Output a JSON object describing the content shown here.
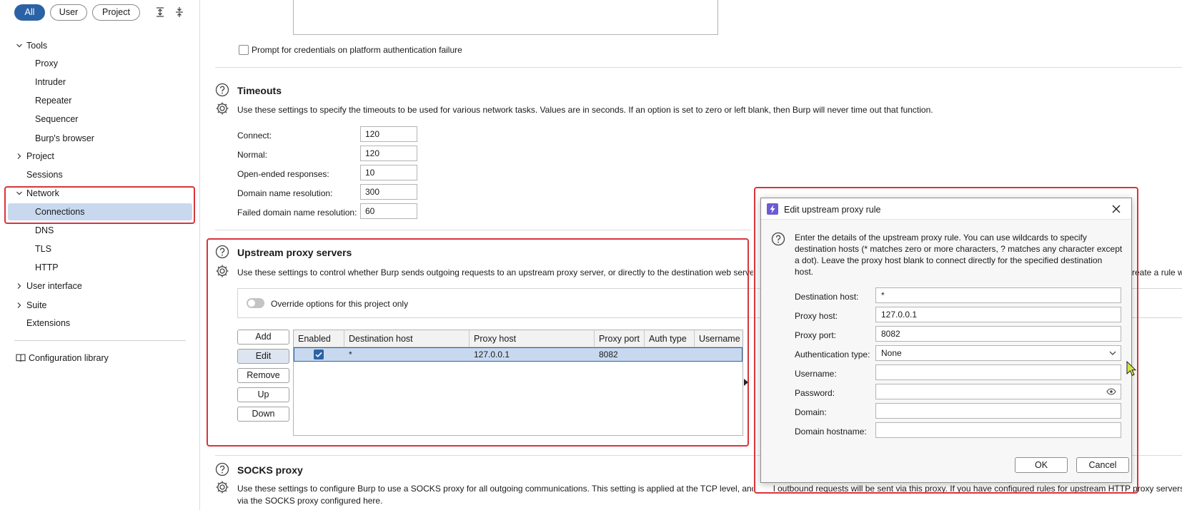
{
  "filters": {
    "all": "All",
    "user": "User",
    "project": "Project"
  },
  "sidebar": {
    "tools": "Tools",
    "proxy": "Proxy",
    "intruder": "Intruder",
    "repeater": "Repeater",
    "sequencer": "Sequencer",
    "burps_browser": "Burp's browser",
    "project": "Project",
    "sessions": "Sessions",
    "network": "Network",
    "connections": "Connections",
    "dns": "DNS",
    "tls": "TLS",
    "http": "HTTP",
    "user_interface": "User interface",
    "suite": "Suite",
    "extensions": "Extensions",
    "configuration_library": "Configuration library"
  },
  "auth": {
    "prompt_label": "Prompt for credentials on platform authentication failure"
  },
  "timeouts": {
    "title": "Timeouts",
    "description": "Use these settings to specify the timeouts to be used for various network tasks. Values are in seconds. If an option is set to zero or left blank, then Burp will never time out that function.",
    "fields": [
      {
        "label": "Connect:",
        "value": "120"
      },
      {
        "label": "Normal:",
        "value": "120"
      },
      {
        "label": "Open-ended responses:",
        "value": "10"
      },
      {
        "label": "Domain name resolution:",
        "value": "300"
      },
      {
        "label": "Failed domain name resolution:",
        "value": "60"
      }
    ]
  },
  "upstream": {
    "title": "Upstream proxy servers",
    "description_left": "Use these settings to control whether Burp sends outgoing requests to an upstream proxy server, or directly to the destination web server. Th",
    "description_right": "reate a rule wi",
    "override_label": "Override options for this project only",
    "buttons": {
      "add": "Add",
      "edit": "Edit",
      "remove": "Remove",
      "up": "Up",
      "down": "Down"
    },
    "columns": [
      "Enabled",
      "Destination host",
      "Proxy host",
      "Proxy port",
      "Auth type",
      "Username"
    ],
    "rows": [
      {
        "enabled": true,
        "destination_host": "*",
        "proxy_host": "127.0.0.1",
        "proxy_port": "8082",
        "auth_type": "",
        "username": ""
      }
    ]
  },
  "socks": {
    "title": "SOCKS proxy",
    "description_line1_left": "Use these settings to configure Burp to use a SOCKS proxy for all outgoing communications. This setting is applied at the TCP level, and a",
    "description_line1_right": "l outbound requests will be sent via this proxy. If you have configured rules for upstream HTTP proxy servers, then",
    "description_line2": "via the SOCKS proxy configured here."
  },
  "dialog": {
    "title": "Edit upstream proxy rule",
    "info_lines": [
      "Enter the details of the upstream proxy rule. You can use wildcards to specify",
      "destination hosts (* matches zero or more characters, ? matches any character except",
      "a dot). Leave the proxy host blank to connect directly for the specified destination",
      "host."
    ],
    "fields": {
      "destination_host": {
        "label": "Destination host:",
        "value": "*"
      },
      "proxy_host": {
        "label": "Proxy host:",
        "value": "127.0.0.1"
      },
      "proxy_port": {
        "label": "Proxy port:",
        "value": "8082"
      },
      "authentication_type": {
        "label": "Authentication type:",
        "value": "None"
      },
      "username": {
        "label": "Username:",
        "value": ""
      },
      "password": {
        "label": "Password:",
        "value": ""
      },
      "domain": {
        "label": "Domain:",
        "value": ""
      },
      "domain_hostname": {
        "label": "Domain hostname:",
        "value": ""
      }
    },
    "ok": "OK",
    "cancel": "Cancel"
  },
  "colors": {
    "accent": "#2b62a6",
    "selection": "#c8d9ef",
    "highlight_box": "#d9343a",
    "burp_logo": "#6b5bd6"
  }
}
